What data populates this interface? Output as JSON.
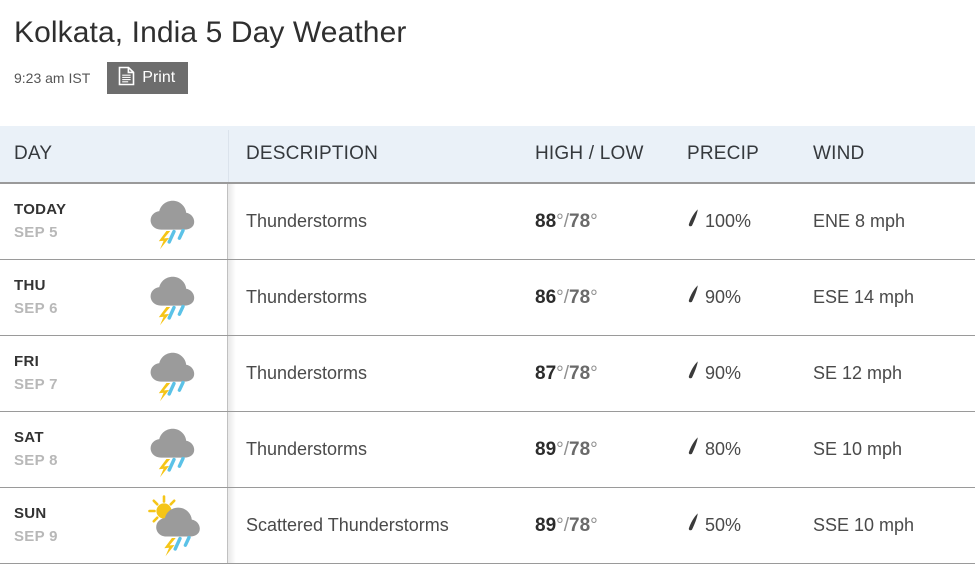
{
  "header": {
    "title": "Kolkata, India 5 Day Weather",
    "timestamp": "9:23 am IST",
    "print_label": "Print",
    "print_icon": "document-icon"
  },
  "table": {
    "columns": {
      "day": "DAY",
      "description": "DESCRIPTION",
      "high_low": "HIGH / LOW",
      "precip": "PRECIP",
      "wind": "WIND"
    },
    "rows": [
      {
        "day": "TODAY",
        "date": "SEP 5",
        "icon": "thunderstorm-icon",
        "description": "Thunderstorms",
        "high": "88",
        "low": "78",
        "temp_separator": "°/",
        "low_degree": "°",
        "precip": "100%",
        "precip_icon": "raindrop-icon",
        "wind": "ENE 8 mph"
      },
      {
        "day": "THU",
        "date": "SEP 6",
        "icon": "thunderstorm-icon",
        "description": "Thunderstorms",
        "high": "86",
        "low": "78",
        "temp_separator": "°/",
        "low_degree": "°",
        "precip": "90%",
        "precip_icon": "raindrop-icon",
        "wind": "ESE 14 mph"
      },
      {
        "day": "FRI",
        "date": "SEP 7",
        "icon": "thunderstorm-icon",
        "description": "Thunderstorms",
        "high": "87",
        "low": "78",
        "temp_separator": "°/",
        "low_degree": "°",
        "precip": "90%",
        "precip_icon": "raindrop-icon",
        "wind": "SE 12 mph"
      },
      {
        "day": "SAT",
        "date": "SEP 8",
        "icon": "thunderstorm-icon",
        "description": "Thunderstorms",
        "high": "89",
        "low": "78",
        "temp_separator": "°/",
        "low_degree": "°",
        "precip": "80%",
        "precip_icon": "raindrop-icon",
        "wind": "SE 10 mph"
      },
      {
        "day": "SUN",
        "date": "SEP 9",
        "icon": "scattered-thunderstorm-icon",
        "description": "Scattered Thunderstorms",
        "high": "89",
        "low": "78",
        "temp_separator": "°/",
        "low_degree": "°",
        "precip": "50%",
        "precip_icon": "raindrop-icon",
        "wind": "SSE 10 mph"
      }
    ]
  },
  "colors": {
    "header_background": "#eaf1f8",
    "cloud_gray": "#9b9b9b",
    "lightning_yellow": "#f5c518",
    "rain_blue": "#5bc2e7",
    "sun_yellow": "#f5c518",
    "print_button": "#6d6d6d",
    "row_divider": "#9a9a9a"
  }
}
